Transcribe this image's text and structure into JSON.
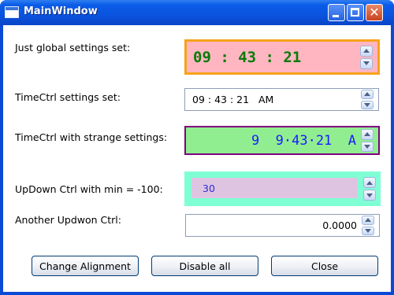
{
  "window": {
    "title": "MainWindow"
  },
  "rows": [
    {
      "label": "Just global settings set:",
      "value": "09 : 43 : 21"
    },
    {
      "label": "TimeCtrl settings set:",
      "value": "09 : 43 : 21   AM"
    },
    {
      "label": "TimeCtrl with strange settings:",
      "value": "9  9·43·21  A"
    },
    {
      "label": "UpDown Ctrl with min = -100:",
      "value": "30"
    },
    {
      "label": "Another Updwon Ctrl:",
      "value": "0.0000"
    }
  ],
  "buttons": {
    "change_alignment": "Change Alignment",
    "disable_all": "Disable all",
    "close": "Close"
  },
  "colors": {
    "title_bar": "#0a53de",
    "field1_bg": "#ffb6c1",
    "field1_border": "#f7a21a",
    "field1_text": "#0a7a0a",
    "field3_bg": "#90ee90",
    "field3_border": "#800080",
    "field3_text": "#1a1aff",
    "field4_frame": "#7fffd4",
    "field4_bg": "#dfc4e2",
    "field4_text": "#2b2bd8"
  }
}
